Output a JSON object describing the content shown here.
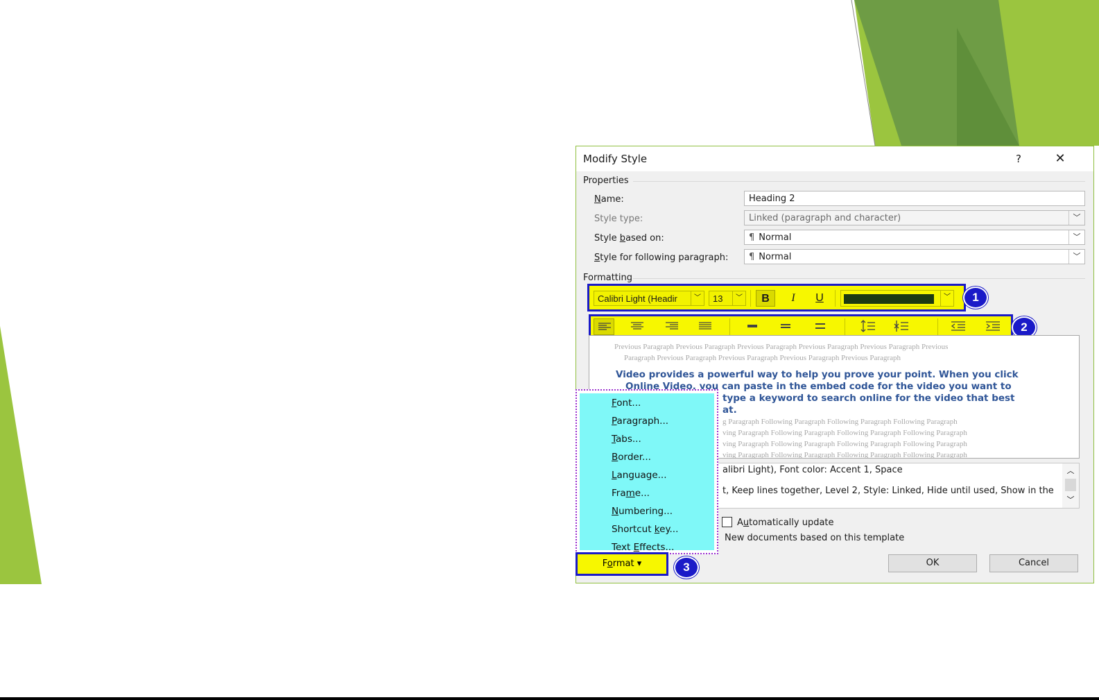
{
  "colors": {
    "slide_green_dark": "#5f8f3a",
    "slide_green_light": "#9bc53f",
    "highlight_yellow": "#f7f700",
    "highlight_blue": "#1a1ac8",
    "menu_cyan": "#7ff8f8",
    "heading_blue": "#2f5597",
    "font_color_swatch": "#1d3b12"
  },
  "dialog": {
    "title": "Modify Style",
    "help_label": "?",
    "close_label": "✕",
    "properties": {
      "section_label": "Properties",
      "name": {
        "label_accel": "N",
        "label_rest": "ame:",
        "value": "Heading 2"
      },
      "style_type": {
        "label": "Style type:",
        "value": "Linked (paragraph and character)"
      },
      "based_on": {
        "label_pre": "Style ",
        "label_accel": "b",
        "label_post": "ased on:",
        "mark": "¶",
        "value": "Normal"
      },
      "following": {
        "label_accel": "S",
        "label_rest": "tyle for following paragraph:",
        "mark": "¶",
        "value": "Normal"
      }
    },
    "formatting": {
      "section_label": "Formatting",
      "font": "Calibri Light (Headir",
      "size": "13",
      "bold": "B",
      "italic": "I",
      "underline": "U"
    },
    "badges": [
      "1",
      "2",
      "3"
    ],
    "preview": {
      "previous_1": "Previous Paragraph Previous Paragraph Previous Paragraph Previous Paragraph Previous Paragraph Previous",
      "previous_2": "Paragraph Previous Paragraph Previous Paragraph Previous Paragraph Previous Paragraph",
      "sample_lines": [
        "Video provides a powerful way to help you prove your point. When you click",
        "Online Video, you can paste in the embed code for the video you want to",
        "type a keyword to search online for the video that best",
        "at."
      ],
      "following_lines": [
        "g Paragraph Following Paragraph Following Paragraph Following Paragraph",
        "ving Paragraph Following Paragraph Following Paragraph Following Paragraph",
        "ving Paragraph Following Paragraph Following Paragraph Following Paragraph",
        "ving Paragraph Following Paragraph Following Paragraph Following Paragraph"
      ]
    },
    "description": {
      "line_1": "alibri Light), Font color: Accent 1, Space",
      "line_2": "t, Keep lines together, Level 2, Style: Linked, Hide until used, Show in the"
    },
    "options": {
      "auto_update_accel": "u",
      "auto_update_pre": "A",
      "auto_update_post": "tomatically update",
      "new_docs": "New documents based on this template"
    },
    "ok_label": "OK",
    "cancel_label": "Cancel"
  },
  "format_menu": {
    "items": [
      {
        "accel": "F",
        "rest": "ont..."
      },
      {
        "accel": "P",
        "rest": "aragraph..."
      },
      {
        "accel": "T",
        "rest": "abs..."
      },
      {
        "accel": "B",
        "rest": "order..."
      },
      {
        "accel": "L",
        "rest": "anguage..."
      },
      {
        "pre": "Fra",
        "accel": "m",
        "rest": "e..."
      },
      {
        "accel": "N",
        "rest": "umbering..."
      },
      {
        "pre": "Shortcut ",
        "accel": "k",
        "rest": "ey..."
      },
      {
        "pre": "Text ",
        "accel": "E",
        "rest": "ffects..."
      }
    ],
    "button": {
      "pre": "F",
      "accel": "o",
      "rest": "rmat",
      "caret": "▾"
    }
  }
}
